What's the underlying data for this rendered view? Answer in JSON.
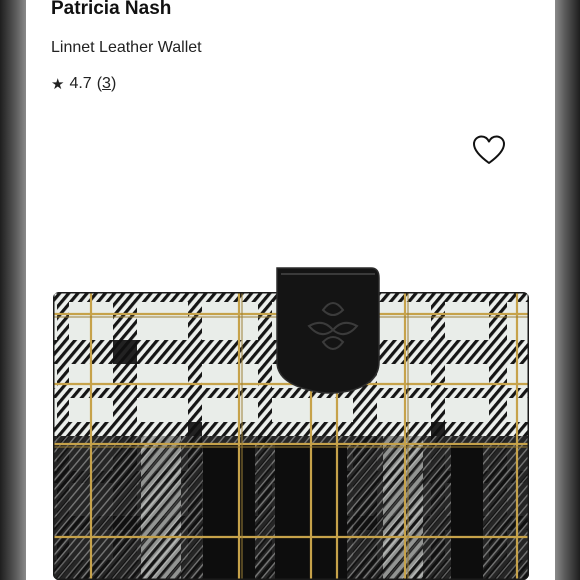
{
  "product": {
    "brand": "Patricia Nash",
    "name": "Linnet Leather Wallet",
    "rating": "4.7",
    "review_count_open": "(",
    "review_count": "3",
    "review_count_close": ")"
  },
  "icons": {
    "rating_star": "star-icon",
    "favorite": "heart-outline-icon"
  },
  "colors": {
    "page_background": "#ffffff",
    "text": "#111111",
    "plaid_white": "#e9ede9",
    "plaid_black": "#141414",
    "plaid_gold": "#c6a24a"
  }
}
